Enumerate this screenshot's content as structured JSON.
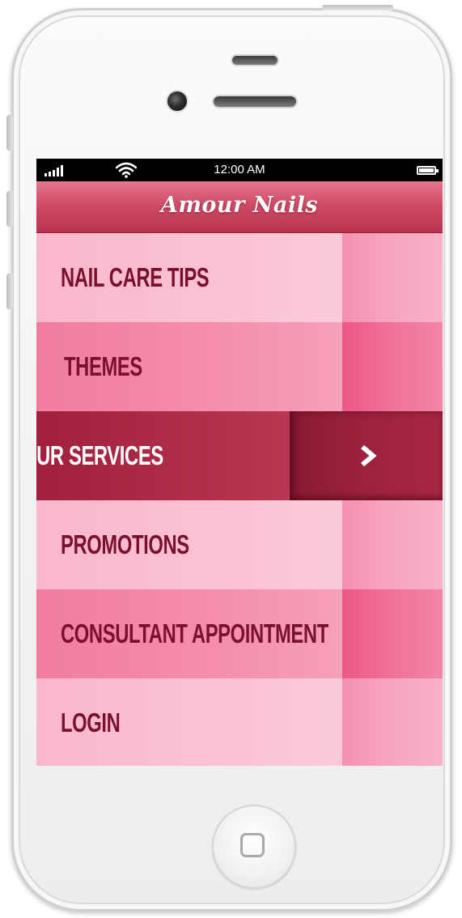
{
  "status_bar": {
    "time": "12:00 AM",
    "signal_icon": "signal-bars-icon",
    "wifi_icon": "wifi-icon",
    "battery_icon": "battery-icon"
  },
  "app": {
    "title": "Amour Nails"
  },
  "menu": {
    "items": [
      {
        "label": "NAIL CARE TIPS",
        "style": "light"
      },
      {
        "label": "THEMES",
        "style": "mid"
      },
      {
        "label": "OUR SERVICES",
        "style": "active",
        "arrow_icon": "chevron-right-icon"
      },
      {
        "label": "PROMOTIONS",
        "style": "light"
      },
      {
        "label": "CONSULTANT APPOINTMENT",
        "style": "mid"
      },
      {
        "label": "LOGIN",
        "style": "light"
      }
    ]
  },
  "colors": {
    "brand": "#c7405f",
    "text": "#7a1030",
    "active": "#a0203d"
  }
}
